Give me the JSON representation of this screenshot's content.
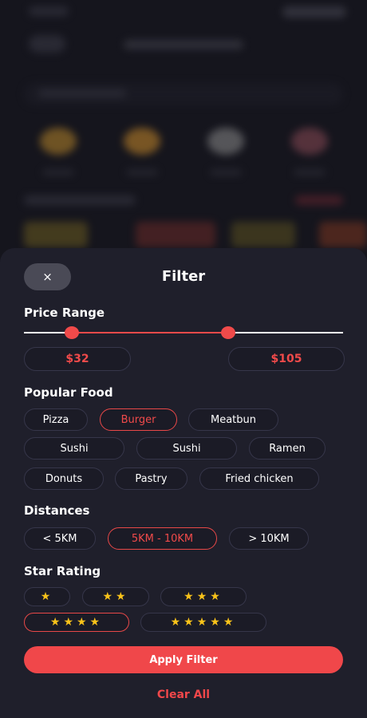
{
  "sheet": {
    "title": "Filter",
    "close_icon": "×"
  },
  "price_range": {
    "title": "Price Range",
    "min_label": "$32",
    "max_label": "$105",
    "min_fraction": 0.15,
    "max_fraction": 0.64
  },
  "popular_food": {
    "title": "Popular Food",
    "items": [
      "Pizza",
      "Burger",
      "Meatbun",
      "Sushi",
      "Sushi",
      "Ramen",
      "Donuts",
      "Pastry",
      "Fried chicken"
    ],
    "selected": "Burger"
  },
  "distances": {
    "title": "Distances",
    "items": [
      "< 5KM",
      "5KM - 10KM",
      "> 10KM"
    ],
    "selected": "5KM - 10KM"
  },
  "star_rating": {
    "title": "Star Rating",
    "items": [
      "★",
      "★★",
      "★★★",
      "★★★★",
      "★★★★★"
    ],
    "selected": "★★★★"
  },
  "actions": {
    "apply": "Apply Filter",
    "clear": "Clear All"
  },
  "colors": {
    "accent": "#f04a4a",
    "sheet_bg": "#1f1f2b",
    "star": "#f8c21a"
  }
}
